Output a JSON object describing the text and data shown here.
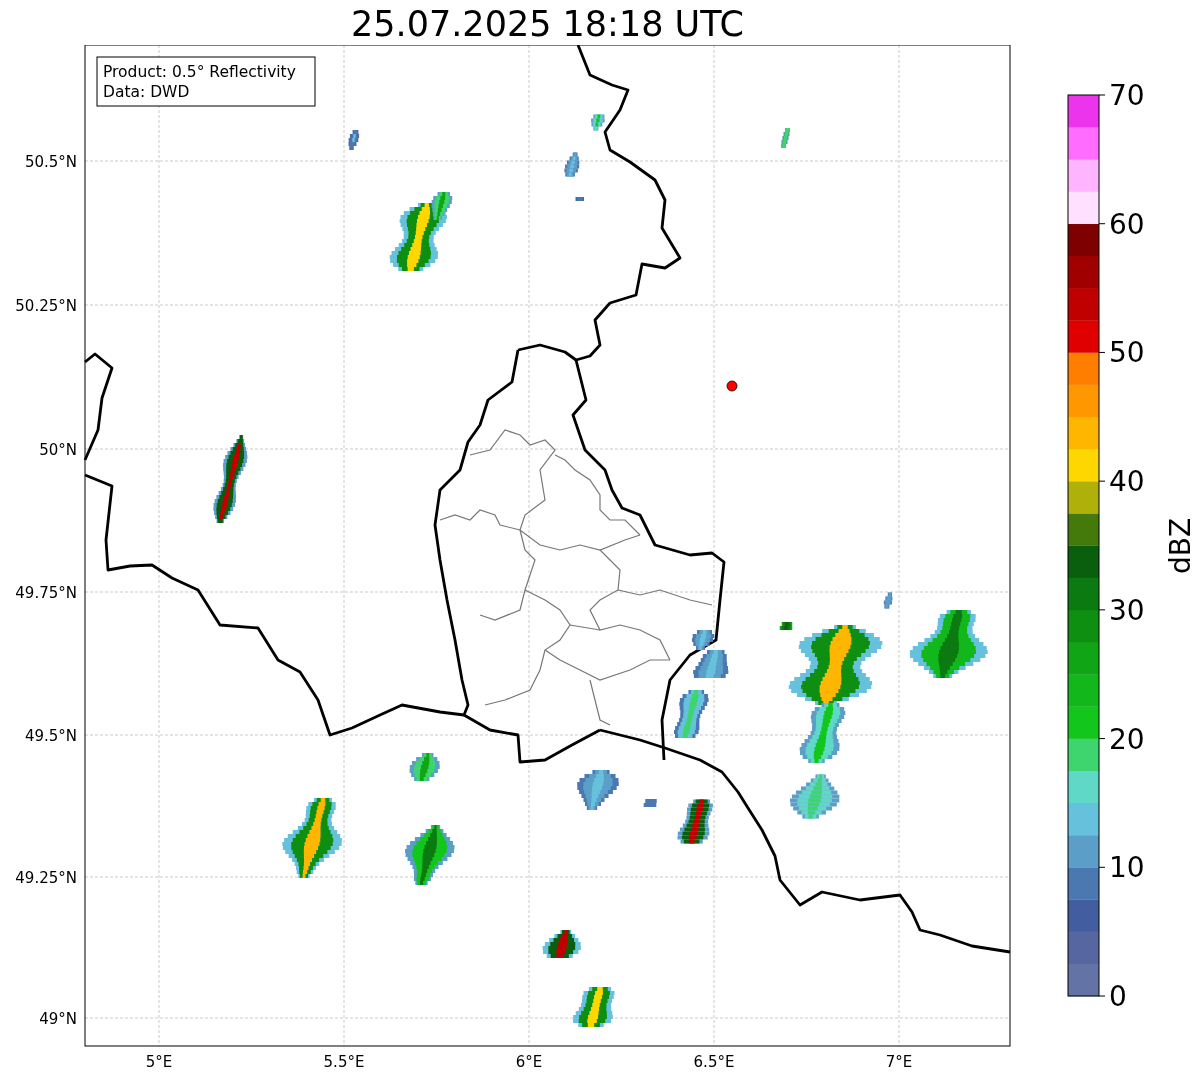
{
  "title": "25.07.2025 18:18 UTC",
  "info": [
    "Product: 0.5° Reflectivity",
    "Data: DWD"
  ],
  "map": {
    "x_ticks": [
      "5°E",
      "5.5°E",
      "6°E",
      "6.5°E",
      "7°E"
    ],
    "y_ticks": [
      "50.5°N",
      "50.25°N",
      "50°N",
      "49.75°N",
      "49.5°N",
      "49.25°N",
      "49°N"
    ]
  },
  "colorbar": {
    "label": "dBZ",
    "ticks": [
      "70",
      "60",
      "50",
      "40",
      "30",
      "20",
      "10",
      "0"
    ],
    "bins": [
      {
        "color": "#6473a6"
      },
      {
        "color": "#5566a0"
      },
      {
        "color": "#425ea1"
      },
      {
        "color": "#4b78b0"
      },
      {
        "color": "#5b9ec7"
      },
      {
        "color": "#66c1dc"
      },
      {
        "color": "#60d8c8"
      },
      {
        "color": "#3ed56e"
      },
      {
        "color": "#12c61c"
      },
      {
        "color": "#12b71b"
      },
      {
        "color": "#10a514"
      },
      {
        "color": "#0e8f12"
      },
      {
        "color": "#0b7a10"
      },
      {
        "color": "#095f0e"
      },
      {
        "color": "#447a0c"
      },
      {
        "color": "#afb10a"
      },
      {
        "color": "#ffd700"
      },
      {
        "color": "#ffb600"
      },
      {
        "color": "#ff9800"
      },
      {
        "color": "#ff7e00"
      },
      {
        "color": "#e10000"
      },
      {
        "color": "#c00000"
      },
      {
        "color": "#a00000"
      },
      {
        "color": "#7e0000"
      },
      {
        "color": "#ffe0ff"
      },
      {
        "color": "#ffb4ff"
      },
      {
        "color": "#ff6cff"
      },
      {
        "color": "#ec34ec"
      }
    ]
  }
}
